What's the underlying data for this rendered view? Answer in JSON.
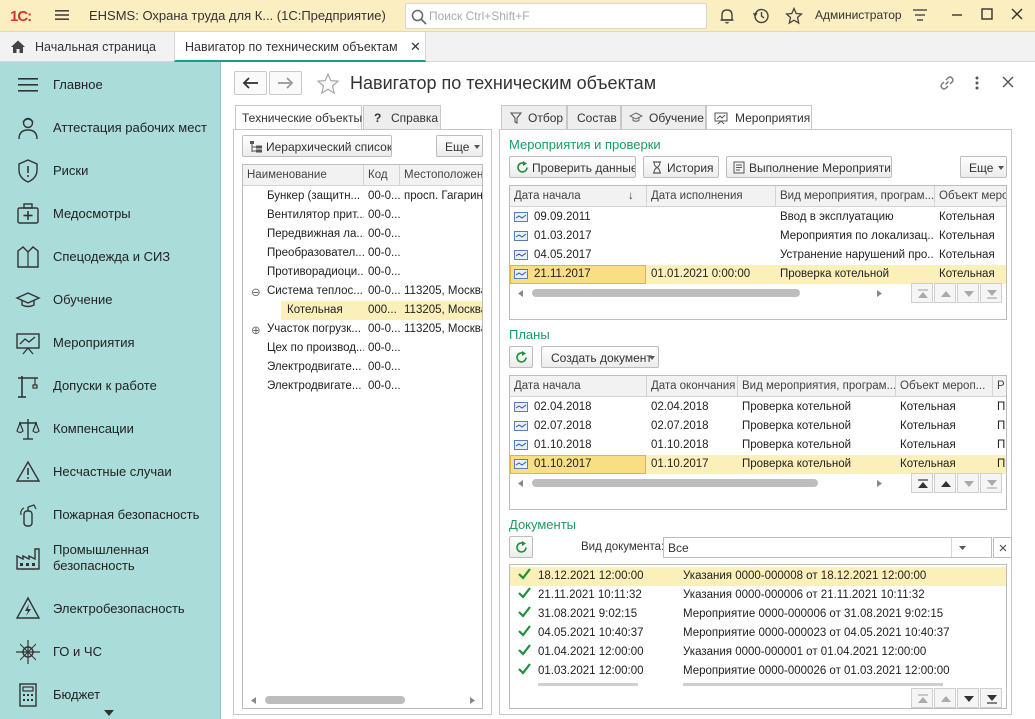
{
  "app": {
    "logo": "1С:",
    "title": "EHSMS: Охрана труда для К...  (1С:Предприятие)",
    "search_placeholder": "Поиск Ctrl+Shift+F",
    "user": "Администратор"
  },
  "tabs": {
    "home": "Начальная страница",
    "current": "Навигатор по техническим объектам",
    "close": "✕"
  },
  "sidebar": {
    "items": [
      {
        "label": "Главное",
        "icon": "menu-lines-icon"
      },
      {
        "label": "Аттестация рабочих мест",
        "icon": "worker-icon"
      },
      {
        "label": "Риски",
        "icon": "shield-icon"
      },
      {
        "label": "Медосмотры",
        "icon": "medkit-icon"
      },
      {
        "label": "Спецодежда и СИЗ",
        "icon": "jacket-icon"
      },
      {
        "label": "Обучение",
        "icon": "graduation-cap-icon"
      },
      {
        "label": "Мероприятия",
        "icon": "presentation-icon"
      },
      {
        "label": "Допуски к работе",
        "icon": "crane-icon"
      },
      {
        "label": "Компенсации",
        "icon": "scales-icon"
      },
      {
        "label": "Несчастные случаи",
        "icon": "warning-icon"
      },
      {
        "label": "Пожарная безопасность",
        "icon": "extinguisher-icon"
      },
      {
        "label": "Промышленная\nбезопасность",
        "icon": "factory-icon"
      },
      {
        "label": "Электробезопасность",
        "icon": "lightning-icon"
      },
      {
        "label": "ГО и ЧС",
        "icon": "compass-icon"
      },
      {
        "label": "Бюджет",
        "icon": "calculator-icon"
      }
    ]
  },
  "form": {
    "title": "Навигатор по техническим объектам",
    "left_tabs": [
      "Технические объекты",
      "Справка"
    ],
    "hier_button": "Иерархический список",
    "more_button": "Еще",
    "tree": {
      "columns": [
        "Наименование",
        "Код",
        "Местоположен"
      ],
      "rows": [
        {
          "name": "Бункер (защитн...",
          "code": "00-0...",
          "loc": "просп. Гагарин",
          "level": 0,
          "toggle": ""
        },
        {
          "name": "Вентилятор прит...",
          "code": "00-0...",
          "loc": "",
          "level": 0,
          "toggle": ""
        },
        {
          "name": "Передвижная ла...",
          "code": "00-0...",
          "loc": "",
          "level": 0,
          "toggle": ""
        },
        {
          "name": "Преобразовател...",
          "code": "00-0...",
          "loc": "",
          "level": 0,
          "toggle": ""
        },
        {
          "name": "Противорадиоци...",
          "code": "00-0...",
          "loc": "",
          "level": 0,
          "toggle": ""
        },
        {
          "name": "Система теплос...",
          "code": "00-0...",
          "loc": "113205, Москва",
          "level": 0,
          "toggle": "⊖"
        },
        {
          "name": "Котельная",
          "code": "000...",
          "loc": "113205, Москва",
          "level": 1,
          "toggle": ""
        },
        {
          "name": "Участок погрузк...",
          "code": "00-0...",
          "loc": "113205, Москва",
          "level": 0,
          "toggle": "⊕"
        },
        {
          "name": "Цех по производ...",
          "code": "00-0...",
          "loc": "",
          "level": 0,
          "toggle": ""
        },
        {
          "name": "Электродвигате...",
          "code": "00-0...",
          "loc": "",
          "level": 0,
          "toggle": ""
        },
        {
          "name": "Электродвигате...",
          "code": "00-0...",
          "loc": "",
          "level": 0,
          "toggle": ""
        }
      ]
    },
    "right_tabs": [
      "Отбор",
      "Состав",
      "Обучение",
      "Мероприятия"
    ],
    "events": {
      "title": "Мероприятия и проверки",
      "check_button": "Проверить данные",
      "history_button": "История",
      "exec_button": "Выполнение Мероприятий",
      "more_button": "Еще",
      "columns": [
        "Дата начала",
        "Дата исполнения",
        "Вид мероприятия, програм...",
        "Объект меро"
      ],
      "sort_arrow": "↓",
      "rows": [
        {
          "start": "09.09.2011",
          "done": "",
          "type": "Ввод в эксплуатацию",
          "object": "Котельная"
        },
        {
          "start": "01.03.2017",
          "done": "",
          "type": "Мероприятия по локализац...",
          "object": "Котельная"
        },
        {
          "start": "04.05.2017",
          "done": "",
          "type": "Устранение нарушений про...",
          "object": "Котельная"
        },
        {
          "start": "21.11.2017",
          "done": "01.01.2021 0:00:00",
          "type": "Проверка котельной",
          "object": "Котельная"
        }
      ]
    },
    "plans": {
      "title": "Планы",
      "create_button": "Создать документ",
      "columns": [
        "Дата начала",
        "Дата окончания",
        "Вид мероприятия, програм...",
        "Объект мероп...",
        "Р"
      ],
      "rows": [
        {
          "start": "02.04.2018",
          "end": "02.04.2018",
          "type": "Проверка котельной",
          "object": "Котельная",
          "extra": "П"
        },
        {
          "start": "02.07.2018",
          "end": "02.07.2018",
          "type": "Проверка котельной",
          "object": "Котельная",
          "extra": "П"
        },
        {
          "start": "01.10.2018",
          "end": "01.10.2018",
          "type": "Проверка котельной",
          "object": "Котельная",
          "extra": "П"
        },
        {
          "start": "01.10.2017",
          "end": "01.10.2017",
          "type": "Проверка котельной",
          "object": "Котельная",
          "extra": "П"
        }
      ]
    },
    "documents": {
      "title": "Документы",
      "doc_type_label": "Вид документа:",
      "doc_type_value": "Все",
      "rows": [
        {
          "date": "18.12.2021 12:00:00",
          "doc": "Указания 0000-000008 от 18.12.2021 12:00:00"
        },
        {
          "date": "21.11.2021 10:11:32",
          "doc": "Указания 0000-000006 от 21.11.2021 10:11:32"
        },
        {
          "date": "31.08.2021 9:02:15",
          "doc": "Мероприятие 0000-000006 от 31.08.2021 9:02:15"
        },
        {
          "date": "04.05.2021 10:40:37",
          "doc": "Мероприятие 0000-000023 от 04.05.2021 10:40:37"
        },
        {
          "date": "01.04.2021 12:00:00",
          "doc": "Указания 0000-000001 от 01.04.2021 12:00:00"
        },
        {
          "date": "01.03.2021 12:00:00",
          "doc": "Мероприятие 0000-000026 от 01.03.2021 12:00:00"
        }
      ]
    }
  }
}
